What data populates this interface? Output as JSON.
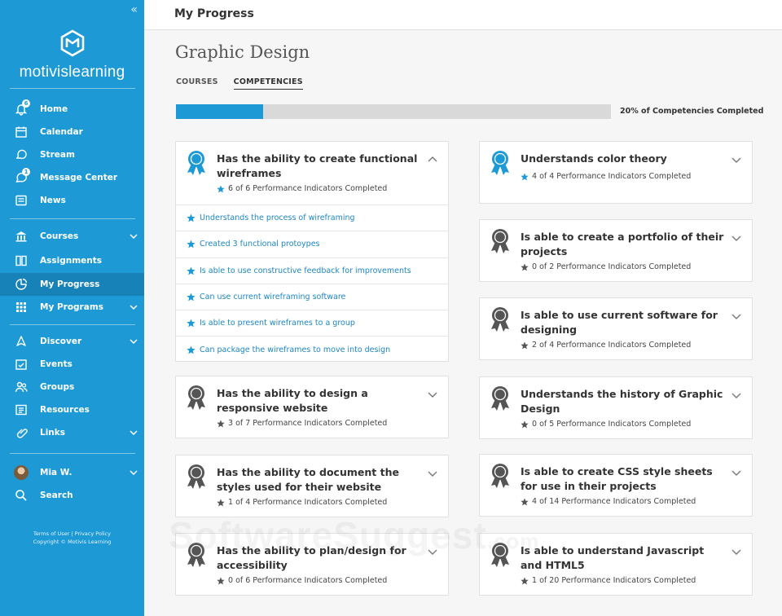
{
  "sidebar": {
    "collapse": "«",
    "logo_text": "motivislearning",
    "items": [
      {
        "label": "Home",
        "icon": "bell-icon",
        "badge": "6"
      },
      {
        "label": "Calendar",
        "icon": "calendar-icon"
      },
      {
        "label": "Stream",
        "icon": "chat-icon"
      },
      {
        "label": "Message Center",
        "icon": "message-icon",
        "badge": "1"
      },
      {
        "label": "News",
        "icon": "news-icon"
      },
      {
        "label": "Courses",
        "icon": "courses-icon"
      },
      {
        "label": "Assignments",
        "icon": "assignments-icon"
      },
      {
        "label": "My Progress",
        "icon": "progress-icon"
      },
      {
        "label": "My Programs",
        "icon": "grid-icon"
      },
      {
        "label": "Discover",
        "icon": "discover-icon"
      },
      {
        "label": "Events",
        "icon": "events-icon"
      },
      {
        "label": "Groups",
        "icon": "groups-icon"
      },
      {
        "label": "Resources",
        "icon": "resources-icon"
      },
      {
        "label": "Links",
        "icon": "link-icon"
      },
      {
        "label": "Mia W.",
        "icon": "avatar"
      },
      {
        "label": "Search",
        "icon": "search-icon"
      }
    ],
    "footer_line1": "Terms of User | Privacy Policy",
    "footer_line2": "Copyright © Motivis Learning"
  },
  "header": {
    "title": "My Progress"
  },
  "main": {
    "title": "Graphic Design",
    "tabs": [
      {
        "label": "COURSES"
      },
      {
        "label": "COMPETENCIES"
      }
    ],
    "progress": {
      "percent": 20,
      "label": "20% of Competencies Completed"
    }
  },
  "cards": [
    {
      "title": "Has the ability to create functional wireframes",
      "status": "6 of 6 Performance Indicators Completed",
      "completed": true,
      "expanded": true,
      "indicators": [
        "Understands the process of wireframing",
        "Created 3 functional protoypes",
        "Is able to use constructive feedback for improvements",
        "Can use current wireframing software",
        "Is able to present wireframes to a group",
        "Can package the wireframes to move into design"
      ]
    },
    {
      "title": "Has the ability to design a responsive website",
      "status": "3 of 7 Performance Indicators Completed",
      "completed": false
    },
    {
      "title": "Has the ability to document the styles used for their website",
      "status": "1 of 4 Performance Indicators Completed",
      "completed": false
    },
    {
      "title": "Has the ability to plan/design for accessibility",
      "status": "0 of 6 Performance Indicators Completed",
      "completed": false
    },
    {
      "title": "Understands color theory",
      "status": "4 of 4 Performance Indicators Completed",
      "completed": true
    },
    {
      "title": "Is able to create a portfolio of their projects",
      "status": "0 of 2 Performance Indicators Completed",
      "completed": false
    },
    {
      "title": "Is able to use current software for designing",
      "status": "2 of 4 Performance Indicators Completed",
      "completed": false
    },
    {
      "title": "Understands the history of Graphic Design",
      "status": "0 of 5 Performance Indicators Completed",
      "completed": false
    },
    {
      "title": "Is able to create CSS style sheets for use in their projects",
      "status": "4 of 14 Performance Indicators Completed",
      "completed": false
    },
    {
      "title": "Is able to understand Javascript and HTML5",
      "status": "1 of 20 Performance Indicators Completed",
      "completed": false
    }
  ],
  "watermark": {
    "main": "SoftwareSuggest",
    "suffix": ".com"
  },
  "colors": {
    "accent": "#1d9ad6",
    "accent_dark": "#1782b8",
    "incomplete": "#555555",
    "link": "#1d86c4"
  }
}
